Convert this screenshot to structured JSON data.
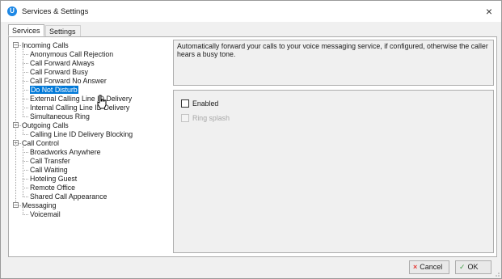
{
  "window": {
    "title": "Services & Settings",
    "close_glyph": "×",
    "app_icon_letter": "U"
  },
  "tabs": [
    {
      "label": "Services",
      "active": true
    },
    {
      "label": "Settings",
      "active": false
    }
  ],
  "tree": {
    "items": [
      {
        "label": "Incoming Calls",
        "level": 0,
        "expander": "−"
      },
      {
        "label": "Anonymous Call Rejection",
        "level": 1
      },
      {
        "label": "Call Forward Always",
        "level": 1
      },
      {
        "label": "Call Forward Busy",
        "level": 1
      },
      {
        "label": "Call Forward No Answer",
        "level": 1
      },
      {
        "label": "Do Not Disturb",
        "level": 1,
        "selected": true
      },
      {
        "label": "External Calling Line ID Delivery",
        "level": 1
      },
      {
        "label": "Internal Calling Line ID Delivery",
        "level": 1
      },
      {
        "label": "Simultaneous Ring",
        "level": 1
      },
      {
        "label": "Outgoing Calls",
        "level": 0,
        "expander": "−"
      },
      {
        "label": "Calling Line ID Delivery Blocking",
        "level": 1
      },
      {
        "label": "Call Control",
        "level": 0,
        "expander": "−"
      },
      {
        "label": "Broadworks Anywhere",
        "level": 1
      },
      {
        "label": "Call Transfer",
        "level": 1
      },
      {
        "label": "Call Waiting",
        "level": 1
      },
      {
        "label": "Hoteling Guest",
        "level": 1
      },
      {
        "label": "Remote Office",
        "level": 1
      },
      {
        "label": "Shared Call Appearance",
        "level": 1
      },
      {
        "label": "Messaging",
        "level": 0,
        "expander": "−"
      },
      {
        "label": "Voicemail",
        "level": 1
      }
    ]
  },
  "description": "Automatically forward your calls to your voice messaging service, if configured, otherwise the caller hears a busy tone.",
  "options": {
    "enabled": {
      "label": "Enabled",
      "checked": false,
      "disabled": false
    },
    "ring_splash": {
      "label": "Ring splash",
      "checked": false,
      "disabled": true
    }
  },
  "buttons": {
    "cancel": {
      "label": "Cancel",
      "icon": "×"
    },
    "ok": {
      "label": "OK",
      "icon": "✓"
    }
  },
  "colors": {
    "selection": "#0078d7",
    "cancel_icon": "#e53935",
    "ok_icon": "#43a047",
    "app_icon": "#1e88e5"
  }
}
